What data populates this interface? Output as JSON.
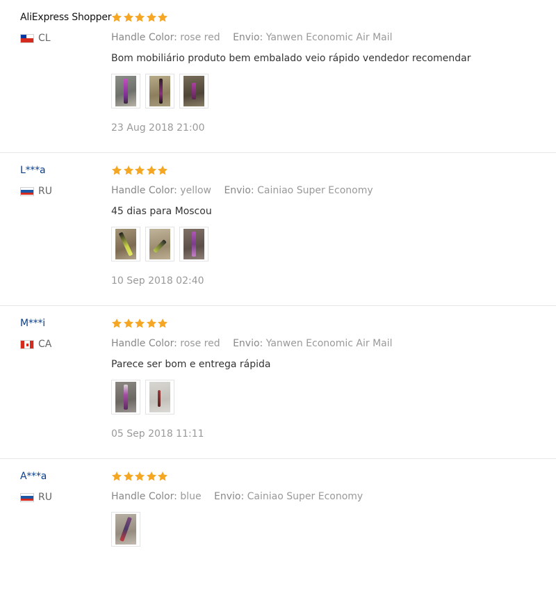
{
  "colors": {
    "star": "#f5a623",
    "username": "#0b3e8a",
    "muted_text": "#999999",
    "divider": "#e6e6e6"
  },
  "reviews": [
    {
      "user": "AliExpress Shopper",
      "country": "CL",
      "flag": "chile-flag-icon",
      "rating": 5,
      "attrs": [
        {
          "label": "Handle Color:",
          "value": "rose red"
        },
        {
          "label": "Envio:",
          "value": "Yanwen Economic Air Mail"
        }
      ],
      "comment": "Bom mobiliário produto bem embalado veio rápido vendedor recomendar",
      "photos": 3,
      "date": "23 Aug 2018 21:00"
    },
    {
      "user": "L***a",
      "country": "RU",
      "flag": "russia-flag-icon",
      "rating": 5,
      "attrs": [
        {
          "label": "Handle Color:",
          "value": "yellow"
        },
        {
          "label": "Envio:",
          "value": "Cainiao Super Economy"
        }
      ],
      "comment": "45 dias para Moscou",
      "photos": 3,
      "date": "10 Sep 2018 02:40"
    },
    {
      "user": "M***i",
      "country": "CA",
      "flag": "canada-flag-icon",
      "rating": 5,
      "attrs": [
        {
          "label": "Handle Color:",
          "value": "rose red"
        },
        {
          "label": "Envio:",
          "value": "Yanwen Economic Air Mail"
        }
      ],
      "comment": "Parece ser bom e entrega rápida",
      "photos": 2,
      "date": "05 Sep 2018 11:11"
    },
    {
      "user": "A***a",
      "country": "RU",
      "flag": "russia-flag-icon",
      "rating": 5,
      "attrs": [
        {
          "label": "Handle Color:",
          "value": "blue"
        },
        {
          "label": "Envio:",
          "value": "Cainiao Super Economy"
        }
      ],
      "comment": "",
      "photos": 1,
      "date": ""
    }
  ]
}
